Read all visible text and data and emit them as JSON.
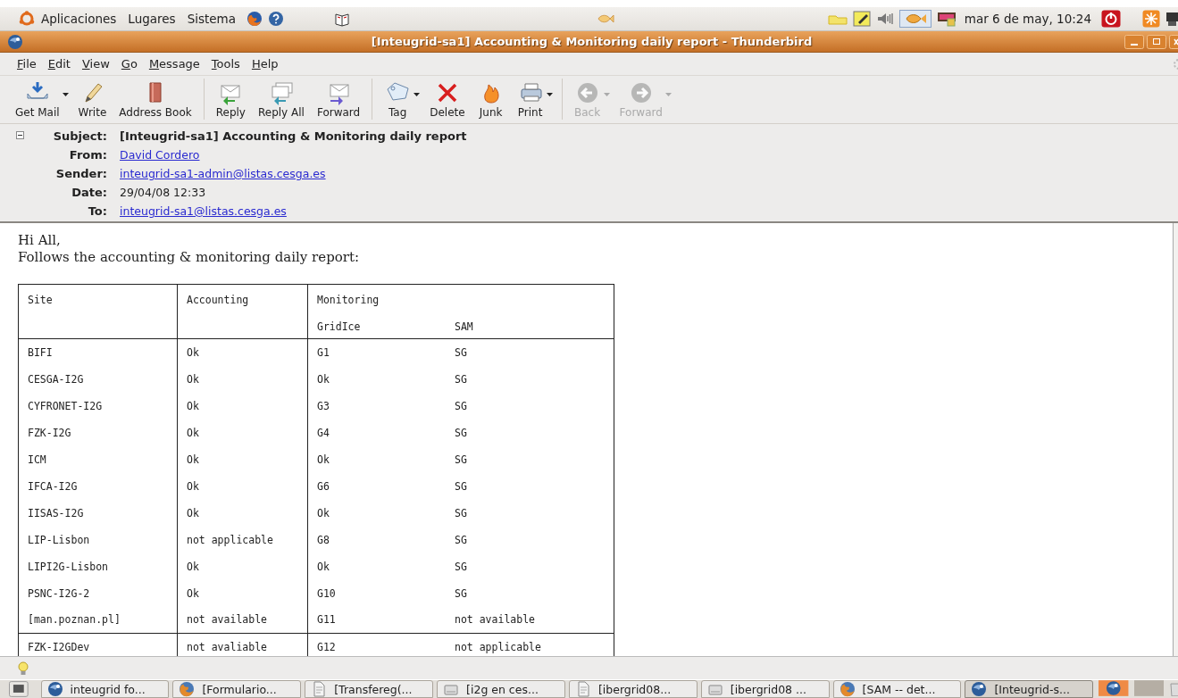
{
  "top_panel": {
    "menus": [
      "Aplicaciones",
      "Lugares",
      "Sistema"
    ],
    "clock": "mar  6 de may, 10:24"
  },
  "window": {
    "title": "[Inteugrid-sa1] Accounting & Monitoring daily report - Thunderbird"
  },
  "menu_bar": [
    "File",
    "Edit",
    "View",
    "Go",
    "Message",
    "Tools",
    "Help"
  ],
  "toolbar": [
    {
      "kind": "getmail",
      "label": "Get Mail",
      "dropdown": true,
      "disabled": false
    },
    {
      "kind": "write",
      "label": "Write",
      "dropdown": false,
      "disabled": false
    },
    {
      "kind": "addressbook",
      "label": "Address Book",
      "dropdown": false,
      "disabled": false
    },
    {
      "kind": "separator"
    },
    {
      "kind": "reply",
      "label": "Reply",
      "dropdown": false,
      "disabled": false
    },
    {
      "kind": "replyall",
      "label": "Reply All",
      "dropdown": false,
      "disabled": false
    },
    {
      "kind": "forward",
      "label": "Forward",
      "dropdown": false,
      "disabled": false
    },
    {
      "kind": "separator"
    },
    {
      "kind": "tag",
      "label": "Tag",
      "dropdown": true,
      "disabled": false
    },
    {
      "kind": "delete",
      "label": "Delete",
      "dropdown": false,
      "disabled": false
    },
    {
      "kind": "junk",
      "label": "Junk",
      "dropdown": false,
      "disabled": false
    },
    {
      "kind": "print",
      "label": "Print",
      "dropdown": true,
      "disabled": false
    },
    {
      "kind": "separator"
    },
    {
      "kind": "back",
      "label": "Back",
      "dropdown": true,
      "disabled": true
    },
    {
      "kind": "next",
      "label": "Forward",
      "dropdown": true,
      "disabled": true
    }
  ],
  "message_header": {
    "expanded": true,
    "fields": [
      {
        "label": "Subject:",
        "value": "[Inteugrid-sa1] Accounting & Monitoring daily report",
        "kind": "subject"
      },
      {
        "label": "From:",
        "value": "David Cordero",
        "kind": "link"
      },
      {
        "label": "Sender:",
        "value": "inteugrid-sa1-admin@listas.cesga.es",
        "kind": "link"
      },
      {
        "label": "Date:",
        "value": "29/04/08 12:33",
        "kind": "text"
      },
      {
        "label": "To:",
        "value": "inteugrid-sa1@listas.cesga.es",
        "kind": "link"
      }
    ]
  },
  "message_body": {
    "lines": [
      "Hi All,",
      "Follows the accounting & monitoring daily report:"
    ],
    "table": {
      "columns": [
        "Site",
        "Accounting",
        "Monitoring"
      ],
      "subcolumns": [
        "GridIce",
        "SAM"
      ],
      "row_groups": [
        [
          [
            "BIFI",
            "Ok",
            "G1",
            "SG"
          ],
          [
            "CESGA-I2G",
            "Ok",
            "Ok",
            "SG"
          ],
          [
            "CYFRONET-I2G",
            "Ok",
            "G3",
            "SG"
          ],
          [
            "FZK-I2G",
            "Ok",
            "G4",
            "SG"
          ],
          [
            "ICM",
            "Ok",
            "Ok",
            "SG"
          ],
          [
            "IFCA-I2G",
            "Ok",
            "G6",
            "SG"
          ],
          [
            "IISAS-I2G",
            "Ok",
            "Ok",
            "SG"
          ],
          [
            "LIP-Lisbon",
            "not applicable",
            "G8",
            "SG"
          ],
          [
            "LIPI2G-Lisbon",
            "Ok",
            "Ok",
            "SG"
          ],
          [
            "PSNC-I2G-2",
            "Ok",
            "G10",
            "SG"
          ],
          [
            "[man.poznan.pl]",
            "not available",
            "G11",
            "not available"
          ]
        ],
        [
          [
            "FZK-I2GDev",
            "not avaliable",
            "G12",
            "not applicable"
          ]
        ]
      ]
    }
  },
  "taskbar": [
    {
      "kind": "mail",
      "label": "inteugrid fo...",
      "selected": false
    },
    {
      "kind": "browser",
      "label": "[Formulario...",
      "selected": false
    },
    {
      "kind": "document",
      "label": "[Transfereg(...",
      "selected": false
    },
    {
      "kind": "drive",
      "label": "[i2g en ces...",
      "selected": false
    },
    {
      "kind": "document",
      "label": "[ibergrid08...",
      "selected": false
    },
    {
      "kind": "drive",
      "label": "[ibergrid08 ...",
      "selected": false
    },
    {
      "kind": "browser",
      "label": "[SAM -- det...",
      "selected": false
    },
    {
      "kind": "mail",
      "label": "[Inteugrid-s...",
      "selected": true
    }
  ]
}
